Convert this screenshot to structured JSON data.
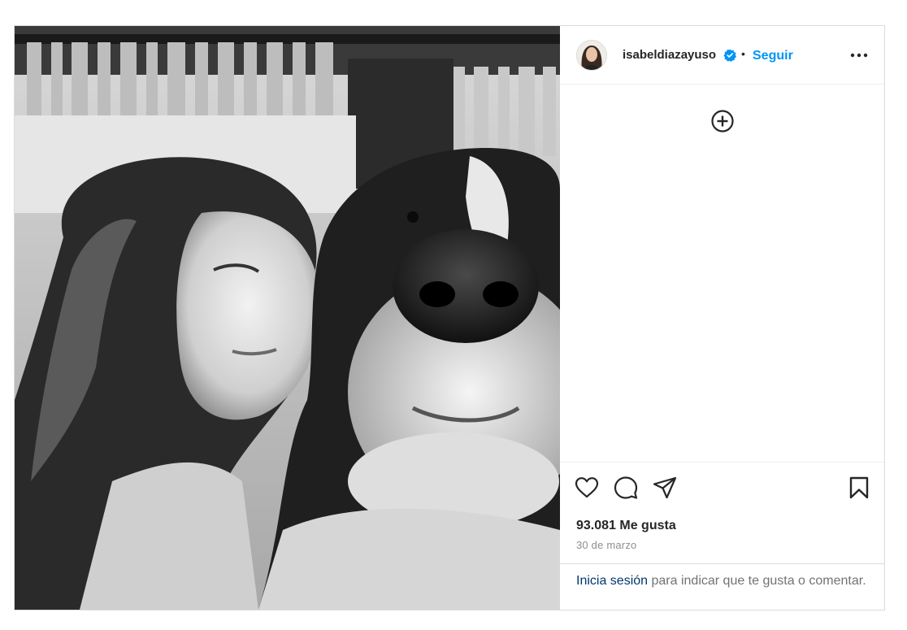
{
  "post": {
    "image_alt": "Retrato en blanco y negro de una mujer junto a un perro",
    "username": "isabeldiazayuso",
    "separator": "•",
    "follow_label": "Seguir",
    "likes": "93.081 Me gusta",
    "date": "30 de marzo",
    "login_link": "Inicia sesión",
    "login_text": " para indicar que te gusta o comentar."
  },
  "icons": {
    "verified": "verified-badge-icon",
    "more": "more-options-icon",
    "add": "add-circle-icon",
    "like": "heart-icon",
    "comment": "comment-icon",
    "share": "share-icon",
    "save": "bookmark-icon"
  },
  "colors": {
    "accent": "#0095f6",
    "link": "#00376b",
    "muted": "#8e8e8e",
    "border": "#dbdbdb"
  }
}
